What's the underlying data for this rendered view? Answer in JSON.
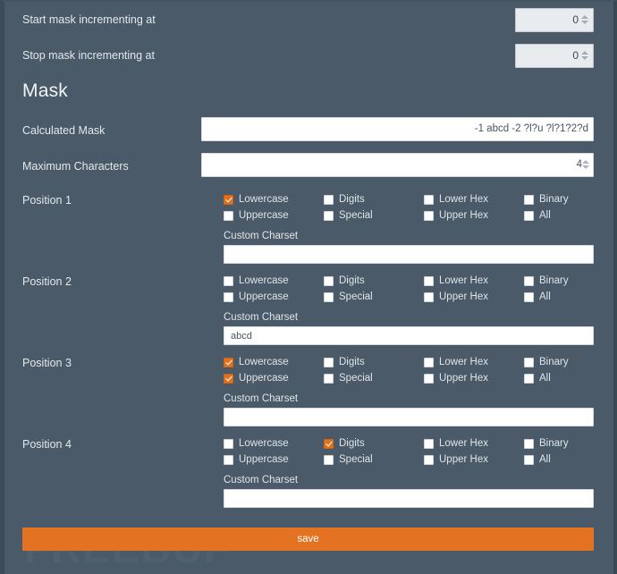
{
  "watermark": "FREEBUF",
  "increment": {
    "start": {
      "label": "Start mask incrementing at",
      "value": "0"
    },
    "stop": {
      "label": "Stop mask incrementing at",
      "value": "0"
    }
  },
  "mask_section": {
    "title": "Mask",
    "calculated_mask": {
      "label": "Calculated Mask",
      "value": "-1 abcd -2 ?l?u ?l?1?2?d"
    },
    "maximum_characters": {
      "label": "Maximum Characters",
      "value": "4"
    }
  },
  "charset_label": "Custom Charset",
  "charset_options": [
    "Lowercase",
    "Digits",
    "Lower Hex",
    "Binary",
    "Uppercase",
    "Special",
    "Upper Hex",
    "All"
  ],
  "positions": [
    {
      "label": "Position 1",
      "checked": {
        "Lowercase": true,
        "Digits": false,
        "Lower Hex": false,
        "Binary": false,
        "Uppercase": false,
        "Special": false,
        "Upper Hex": false,
        "All": false
      },
      "custom_charset": ""
    },
    {
      "label": "Position 2",
      "checked": {
        "Lowercase": false,
        "Digits": false,
        "Lower Hex": false,
        "Binary": false,
        "Uppercase": false,
        "Special": false,
        "Upper Hex": false,
        "All": false
      },
      "custom_charset": "abcd"
    },
    {
      "label": "Position 3",
      "checked": {
        "Lowercase": true,
        "Digits": false,
        "Lower Hex": false,
        "Binary": false,
        "Uppercase": true,
        "Special": false,
        "Upper Hex": false,
        "All": false
      },
      "custom_charset": ""
    },
    {
      "label": "Position 4",
      "checked": {
        "Lowercase": false,
        "Digits": true,
        "Lower Hex": false,
        "Binary": false,
        "Uppercase": false,
        "Special": false,
        "Upper Hex": false,
        "All": false
      },
      "custom_charset": ""
    }
  ],
  "save_label": "save",
  "colors": {
    "background": "#4a5a68",
    "accent": "#e37222",
    "checkbox_checked": "#e0721e",
    "input_background": "#ffffff",
    "number_input_background": "#e9ecef",
    "text": "#e4e9ec"
  }
}
